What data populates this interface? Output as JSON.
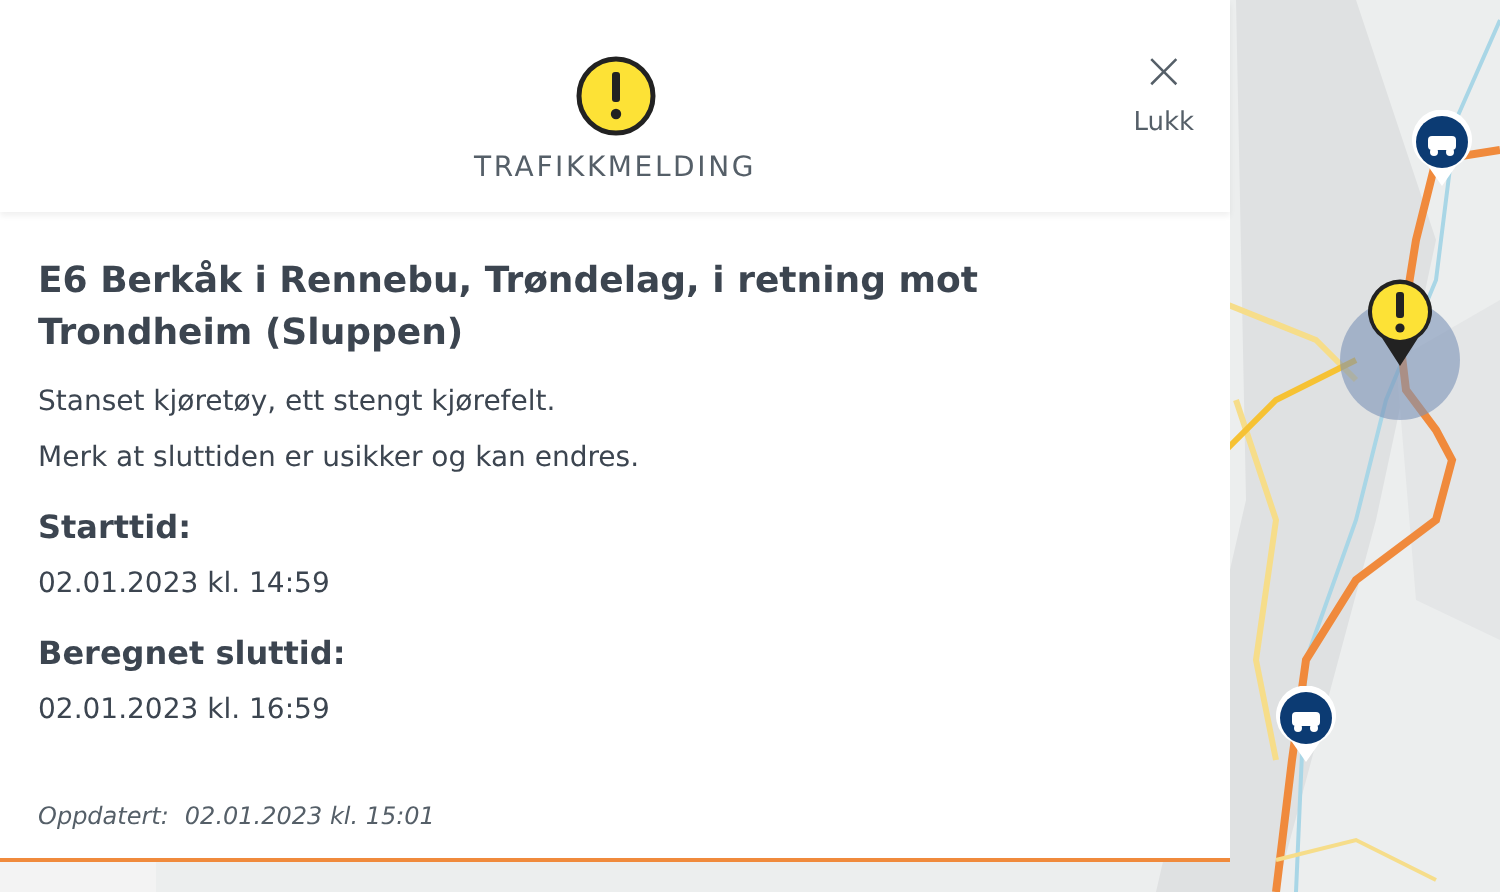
{
  "header": {
    "title": "TRAFIKKMELDING",
    "close_label": "Lukk",
    "close_icon": "×"
  },
  "message": {
    "title": "E6 Berkåk i Rennebu, Trøndelag, i retning mot Trondheim (Sluppen)",
    "lines": [
      "Stanset kjøretøy, ett stengt kjørefelt.",
      "Merk at sluttiden er usikker og kan endres."
    ],
    "fields": [
      {
        "label": "Starttid:",
        "value": "02.01.2023 kl. 14:59"
      },
      {
        "label": "Beregnet sluttid:",
        "value": "02.01.2023 kl. 16:59"
      }
    ],
    "updated": {
      "label": "Oppdatert:",
      "value": "02.01.2023 kl. 15:01"
    }
  }
}
